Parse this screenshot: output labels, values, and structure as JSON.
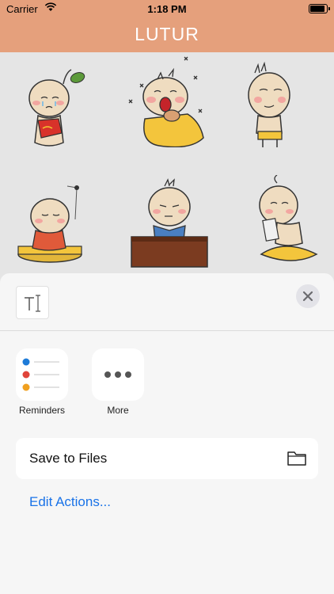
{
  "status_bar": {
    "carrier": "Carrier",
    "time": "1:18 PM"
  },
  "nav": {
    "title": "LUTUR"
  },
  "stickers": [
    {
      "icon": "crying-baby-holding-envelope-sticker"
    },
    {
      "icon": "yawning-baby-on-pillow-sticker"
    },
    {
      "icon": "smirking-baby-standing-sticker"
    },
    {
      "icon": "sad-baby-on-cushion-sticker"
    },
    {
      "icon": "baby-reading-book-at-desk-sticker"
    },
    {
      "icon": "baby-eating-on-cushion-sticker"
    }
  ],
  "share_sheet": {
    "apps": [
      {
        "label": "Reminders",
        "icon": "reminders-icon"
      },
      {
        "label": "More",
        "icon": "more-icon"
      }
    ],
    "actions": [
      {
        "label": "Save to Files",
        "icon": "folder-icon"
      }
    ],
    "edit_actions_label": "Edit Actions..."
  },
  "colors": {
    "nav_background": "#e5a07c",
    "link": "#1a73e8",
    "reminder_dots": [
      "#1e7bd8",
      "#e0443a",
      "#f0a020"
    ]
  }
}
